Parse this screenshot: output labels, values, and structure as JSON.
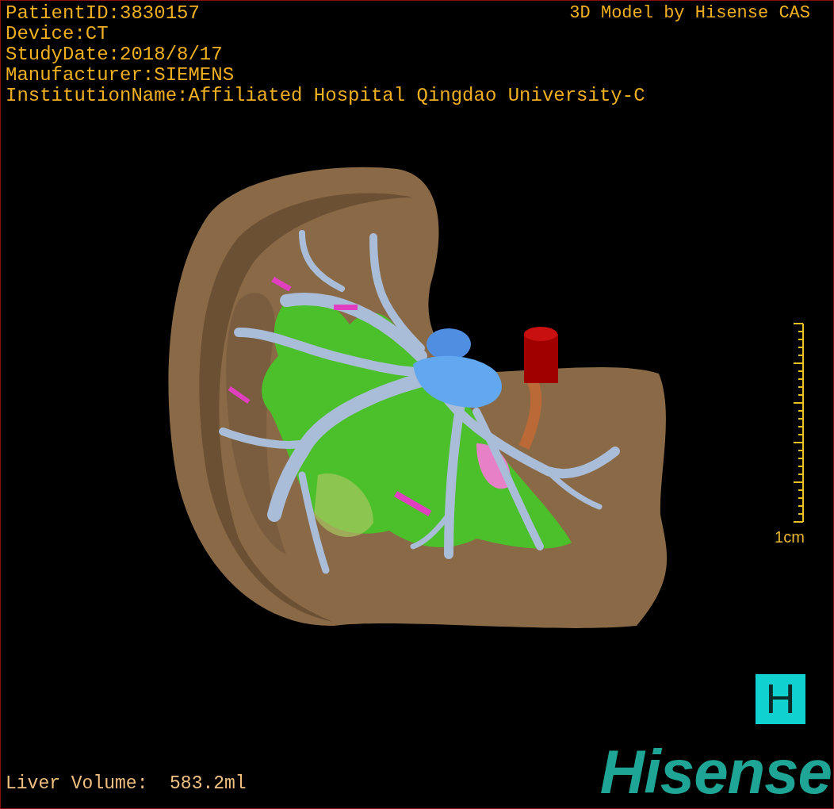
{
  "info_lines": [
    "PatientID:3830157",
    "Device:CT",
    "StudyDate:2018/8/17",
    "Manufacturer:SIEMENS",
    "InstitutionName:Affiliated Hospital Qingdao University-C"
  ],
  "model_title": "3D Model by Hisense CAS",
  "scale_label": "1cm",
  "volume_text": "Liver Volume:  583.2ml",
  "logo_mark": "H",
  "logo_text": "Hisense"
}
